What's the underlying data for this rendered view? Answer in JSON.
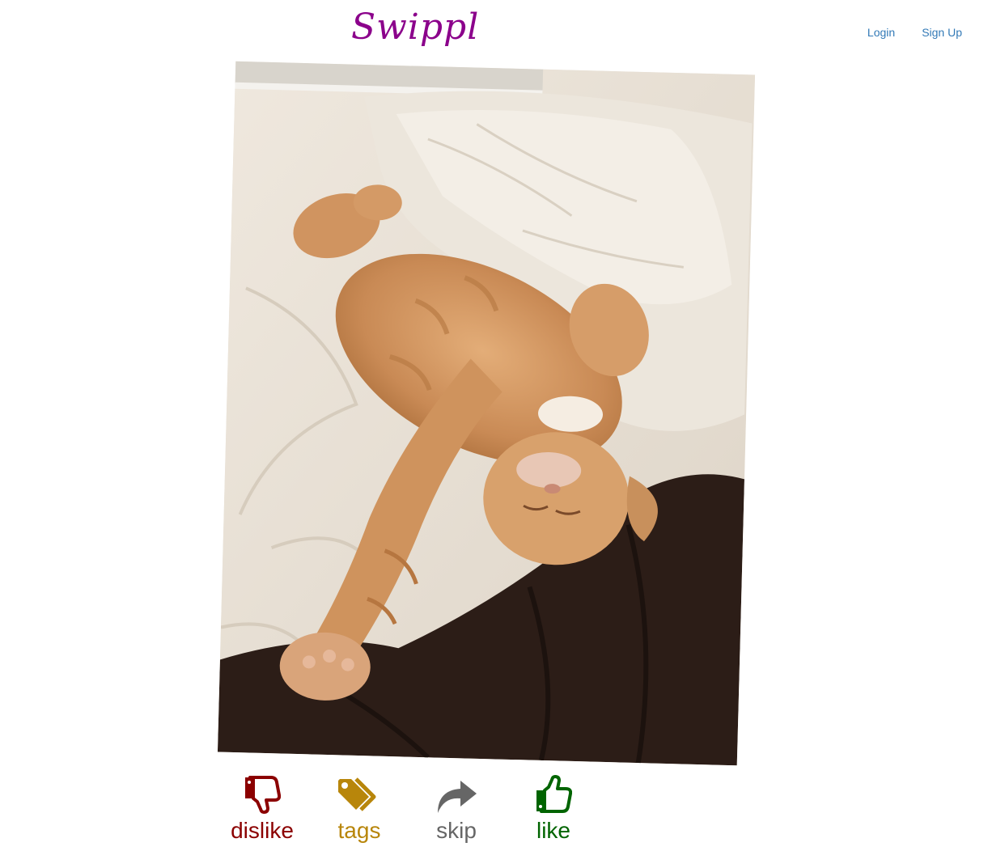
{
  "header": {
    "brand": "Swippl",
    "nav": {
      "login": "Login",
      "signup": "Sign Up"
    }
  },
  "card": {
    "image_subject": "orange tabby cat sleeping on a bed"
  },
  "actions": [
    {
      "label": "dislike",
      "icon": "thumbs-down-icon",
      "color": "#8b0000"
    },
    {
      "label": "tags",
      "icon": "tags-icon",
      "color": "#b8860b"
    },
    {
      "label": "skip",
      "icon": "share-arrow-icon",
      "color": "#666666"
    },
    {
      "label": "like",
      "icon": "thumbs-up-icon",
      "color": "#006400"
    }
  ],
  "colors": {
    "brand": "#8b008b",
    "nav_link": "#337ab7"
  }
}
